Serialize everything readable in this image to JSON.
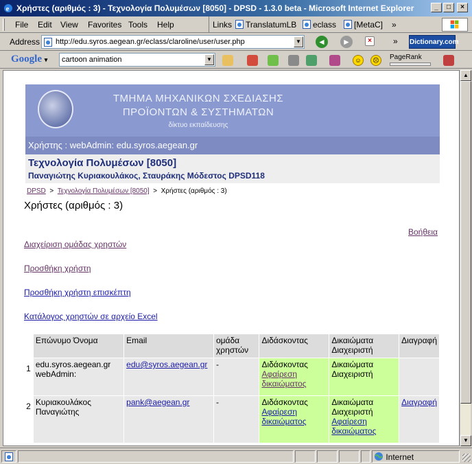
{
  "window": {
    "title": "Χρήστες (αριθμός : 3) - Τεχνολογία Πολυμέσων [8050] - DPSD - 1.3.0 beta - Microsoft Internet Explorer",
    "minimize": "_",
    "maximize": "□",
    "close": "×"
  },
  "menu": {
    "items": [
      "File",
      "Edit",
      "View",
      "Favorites",
      "Tools",
      "Help"
    ],
    "links_label": "Links",
    "links": [
      "TranslatumLB",
      "eclass",
      "[MetaC]"
    ],
    "overflow": "»"
  },
  "address": {
    "label": "Address",
    "url": "http://edu.syros.aegean.gr/eclass/claroline/user/user.php",
    "dictionary": "Dictionary.com"
  },
  "google": {
    "logo": "Google",
    "query": "cartoon animation",
    "pagerank_label": "PageRank"
  },
  "colors": {
    "banner": "#8a9ad0",
    "user_strip": "#7d8bc2",
    "rights_cell": "#ccff99",
    "visited_link": "#663366",
    "link": "#1a1aa6"
  },
  "page": {
    "banner_line1": "ΤΜΗΜΑ ΜΗΧΑΝΙΚΩΝ ΣΧΕΔΙΑΣΗΣ",
    "banner_line2": "ΠΡΟΪΟΝΤΩΝ & ΣΥΣΤΗΜΑΤΩΝ",
    "banner_line3": "δίκτυο εκπαίδευσης",
    "user_strip": "Χρήστης : webAdmin: edu.syros.aegean.gr",
    "course_title": "Τεχνολογία Πολυμέσων [8050]",
    "course_teachers": "Παναγιώτης Κυριακουλάκος, Σταυράκης Μόδεστος DPSD118",
    "breadcrumb": {
      "root": "DPSD",
      "sep": ">",
      "course": "Τεχνολογία Πολυμέσων [8050]",
      "current": "Χρήστες (αριθμός : 3)"
    },
    "heading": "Χρήστες (αριθμός : 3)",
    "help": "Βοήθεια",
    "actions": {
      "manage_groups": "Διαχείριση ομάδας χρηστών",
      "add_user": "Προσθήκη χρήστη",
      "add_guest": "Προσθήκη χρήστη επισκέπτη",
      "export_excel": "Κατάλογος χρηστών σε αρχείο Excel"
    }
  },
  "table": {
    "headers": {
      "name": "Επώνυμο Όνομα",
      "email": "Email",
      "group": "ομάδα χρηστών",
      "teacher": "Διδάσκοντας",
      "admin": "Δικαιώματα Διαχειριστή",
      "delete": "Διαγραφή"
    },
    "rows": [
      {
        "num": "1",
        "name": "edu.syros.aegean.gr webAdmin:",
        "email": "edu@syros.aegean.gr",
        "group": "-",
        "teacher_status": "Διδάσκοντας",
        "teacher_action": "Αφαίρεση δικαιώματος",
        "admin_status": "Δικαιώματα Διαχειριστή",
        "admin_action": "",
        "delete": ""
      },
      {
        "num": "2",
        "name": "Κυριακουλάκος Παναγιώτης",
        "email": "pank@aegean.gr",
        "group": "-",
        "teacher_status": "Διδάσκοντας",
        "teacher_action": "Αφαίρεση δικαιώματος",
        "admin_status": "Δικαιώματα Διαχειριστή",
        "admin_action": "Αφαίρεση δικαιώματος",
        "delete": "Διαγραφή"
      }
    ]
  },
  "status": {
    "zone": "Internet"
  }
}
